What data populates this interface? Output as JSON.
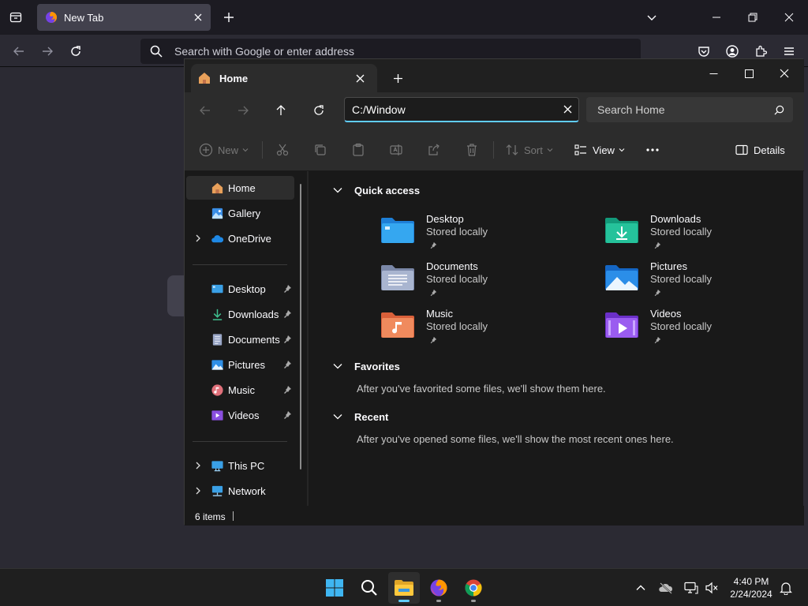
{
  "firefox": {
    "tab_title": "New Tab",
    "url_placeholder": "Search with Google or enter address"
  },
  "explorer": {
    "tab_title": "Home",
    "address_value": "C:/Window",
    "search_placeholder": "Search Home",
    "toolbar": {
      "new_label": "New",
      "sort_label": "Sort",
      "view_label": "View",
      "details_label": "Details"
    },
    "nav": {
      "home": "Home",
      "gallery": "Gallery",
      "onedrive": "OneDrive",
      "desktop": "Desktop",
      "downloads": "Downloads",
      "documents": "Documents",
      "pictures": "Pictures",
      "music": "Music",
      "videos": "Videos",
      "this_pc": "This PC",
      "network": "Network"
    },
    "quick_access": {
      "heading": "Quick access",
      "items": [
        {
          "name": "Desktop",
          "sub": "Stored locally"
        },
        {
          "name": "Downloads",
          "sub": "Stored locally"
        },
        {
          "name": "Documents",
          "sub": "Stored locally"
        },
        {
          "name": "Pictures",
          "sub": "Stored locally"
        },
        {
          "name": "Music",
          "sub": "Stored locally"
        },
        {
          "name": "Videos",
          "sub": "Stored locally"
        }
      ]
    },
    "favorites": {
      "heading": "Favorites",
      "empty": "After you've favorited some files, we'll show them here."
    },
    "recent": {
      "heading": "Recent",
      "empty": "After you've opened some files, we'll show the most recent ones here."
    },
    "status": {
      "item_count": "6 items"
    }
  },
  "taskbar": {
    "time": "4:40 PM",
    "date": "2/24/2024"
  },
  "colors": {
    "accent": "#60cdff",
    "explorer_bg": "#191919",
    "firefox_bg": "#2b2a33"
  }
}
